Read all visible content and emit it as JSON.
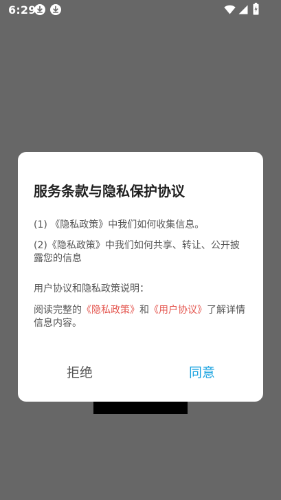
{
  "status_bar": {
    "time": "6:29",
    "icons": [
      "download-icon",
      "download-icon",
      "wifi-icon",
      "signal-icon",
      "battery-charging-icon"
    ]
  },
  "dialog": {
    "title": "服务条款与隐私保护协议",
    "item1": "(1) 《隐私政策》中我们如何收集信息。",
    "item2": "(2)《隐私政策》中我们如何共享、转让、公开披露您的信息",
    "item3": "用户协议和隐私政策说明：",
    "item4": {
      "prefix": "阅读完整的",
      "privacy_link": "《隐私政策》",
      "middle": "和",
      "terms_link": "《用户协议》",
      "suffix": "了解详情信息内容。"
    },
    "reject_label": "拒绝",
    "agree_label": "同意"
  },
  "colors": {
    "backdrop": "#676767",
    "dialog_bg": "#ffffff",
    "link": "#e4564f",
    "agree": "#1aa3e0",
    "reject": "#555555"
  }
}
